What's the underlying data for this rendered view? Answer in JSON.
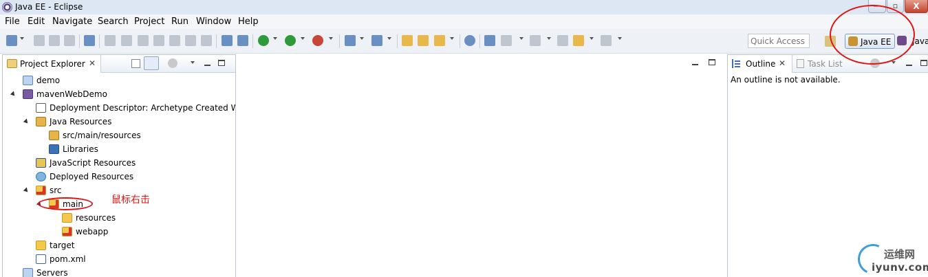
{
  "window": {
    "title": "Java EE - Eclipse",
    "controls": {
      "minimize": "—",
      "maximize": "▫",
      "close": "X"
    }
  },
  "menu": [
    "File",
    "Edit",
    "Navigate",
    "Search",
    "Project",
    "Run",
    "Window",
    "Help"
  ],
  "toolbar": {
    "quick_access_placeholder": "Quick Access",
    "perspectives": {
      "active": "Java EE",
      "other": "Java"
    }
  },
  "project_explorer": {
    "tab_label": "Project Explorer",
    "close_glyph": "✕",
    "tree": [
      {
        "label": "demo",
        "depth": 0,
        "twisty": "none",
        "icon": "folder-blue-icon"
      },
      {
        "label": "mavenWebDemo",
        "depth": 0,
        "twisty": "open",
        "icon": "web-project-icon"
      },
      {
        "label": "Deployment Descriptor: Archetype Created Web Application",
        "depth": 1,
        "twisty": "closed",
        "icon": "deployment-descriptor-icon"
      },
      {
        "label": "Java Resources",
        "depth": 1,
        "twisty": "open",
        "icon": "java-resources-icon"
      },
      {
        "label": "src/main/resources",
        "depth": 2,
        "twisty": "closed",
        "icon": "source-folder-icon"
      },
      {
        "label": "Libraries",
        "depth": 2,
        "twisty": "closed",
        "icon": "libraries-icon"
      },
      {
        "label": "JavaScript Resources",
        "depth": 1,
        "twisty": "closed",
        "icon": "javascript-resources-icon"
      },
      {
        "label": "Deployed Resources",
        "depth": 1,
        "twisty": "closed",
        "icon": "deployed-resources-icon"
      },
      {
        "label": "src",
        "depth": 1,
        "twisty": "open",
        "icon": "src-folder-icon"
      },
      {
        "label": "main",
        "depth": 2,
        "twisty": "open",
        "icon": "src-folder-icon"
      },
      {
        "label": "resources",
        "depth": 3,
        "twisty": "none",
        "icon": "folder-icon"
      },
      {
        "label": "webapp",
        "depth": 3,
        "twisty": "closed",
        "icon": "src-folder-icon"
      },
      {
        "label": "target",
        "depth": 1,
        "twisty": "closed",
        "icon": "folder-icon"
      },
      {
        "label": "pom.xml",
        "depth": 1,
        "twisty": "none",
        "icon": "maven-pom-icon"
      },
      {
        "label": "Servers",
        "depth": 0,
        "twisty": "none",
        "icon": "servers-folder-icon"
      }
    ]
  },
  "annotation": {
    "text": "鼠标右击",
    "color": "#e01515"
  },
  "outline": {
    "tab_label": "Outline",
    "close_glyph": "✕",
    "task_list_label": "Task List",
    "message": "An outline is not available."
  },
  "watermark": {
    "cn": "运维网",
    "en": "iyunv.com"
  }
}
